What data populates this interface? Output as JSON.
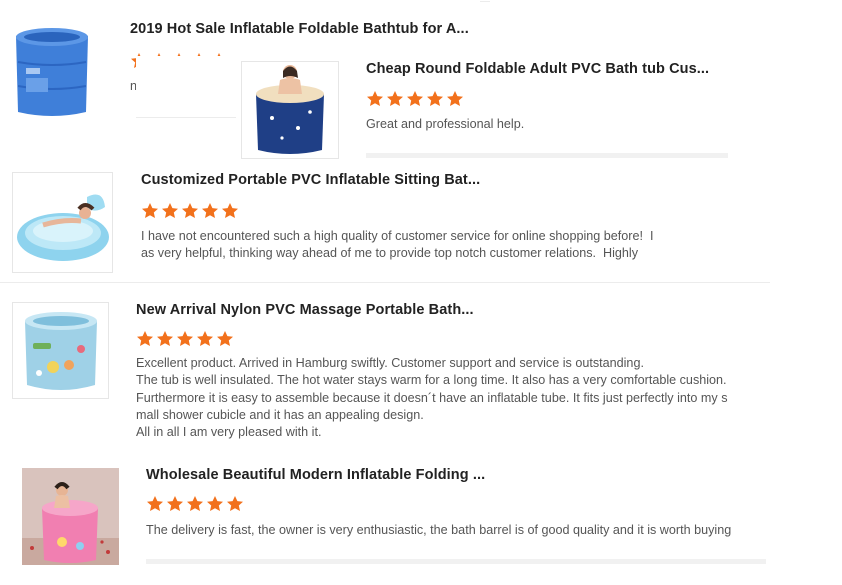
{
  "theme": {
    "star_color": "#f2711c",
    "title_color": "#222222",
    "text_color": "#555555"
  },
  "reviews": [
    {
      "title": "2019 Hot Sale Inflatable Foldable Bathtub for A...",
      "rating": 5,
      "image_icon": "blue-round-bathtub-icon",
      "text": "n"
    },
    {
      "title": "Cheap Round Foldable Adult PVC Bath tub Cus...",
      "rating": 5,
      "image_icon": "dark-blue-bathtub-with-woman-icon",
      "text": "Great and professional help."
    },
    {
      "title": "Customized Portable PVC Inflatable Sitting Bat...",
      "rating": 5,
      "image_icon": "light-blue-inflatable-tub-icon",
      "text": "I have not encountered such a high quality of customer service for online shopping before!  I\nas very helpful, thinking way ahead of me to provide top notch customer relations.  Highly"
    },
    {
      "title": "New Arrival Nylon PVC Massage Portable Bath...",
      "rating": 5,
      "image_icon": "cartoon-print-bathtub-icon",
      "text": "Excellent product. Arrived in Hamburg swiftly. Customer support and service is outstanding.\nThe tub is well insulated. The hot water stays warm for a long time. It also has a very comfortable cushion.\nFurthermore it is easy to assemble because it doesn´t have an inflatable tube. It fits just perfectly into my s\nmall shower cubicle and it has an appealing design.\nAll in all I am very pleased with it."
    },
    {
      "title": "Wholesale Beautiful Modern Inflatable Folding ...",
      "rating": 5,
      "image_icon": "pink-bathtub-with-child-icon",
      "text": "The delivery is fast, the owner is very enthusiastic, the bath barrel is of good quality and it is worth buying"
    }
  ]
}
